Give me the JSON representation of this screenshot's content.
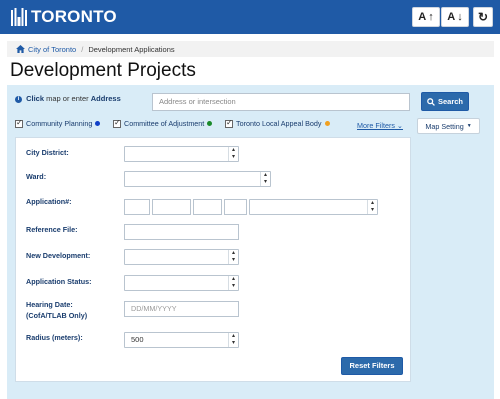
{
  "header": {
    "logo_text": "TORONTO",
    "increase_font_label": "A",
    "decrease_font_label": "A",
    "brand_color": "#1f5aa6"
  },
  "breadcrumb": {
    "home_label": "City of Toronto",
    "current_label": "Development Applications"
  },
  "page_title": "Development Projects",
  "search": {
    "hint_click": "Click",
    "hint_middle": "map or enter",
    "hint_address": "Address",
    "placeholder": "Address or intersection",
    "button_label": "Search"
  },
  "filter_toggles": [
    {
      "label": "Community Planning",
      "checked": true,
      "dot_color": "#1040c8"
    },
    {
      "label": "Committee of Adjustment",
      "checked": true,
      "dot_color": "#1a8a2a"
    },
    {
      "label": "Toronto Local Appeal Body",
      "checked": true,
      "dot_color": "#f0a020"
    }
  ],
  "more_filters_label": "More Filters",
  "map_setting_label": "Map Setting",
  "form": {
    "city_district_label": "City District:",
    "ward_label": "Ward:",
    "application_label": "Application#:",
    "reference_file_label": "Reference File:",
    "new_development_label": "New Development:",
    "application_status_label": "Application Status:",
    "hearing_date_label_1": "Hearing Date:",
    "hearing_date_label_2": "(CofA/TLAB Only)",
    "hearing_date_placeholder": "DD/MM/YYYY",
    "radius_label": "Radius (meters):",
    "radius_value": "500",
    "reset_label": "Reset Filters"
  }
}
